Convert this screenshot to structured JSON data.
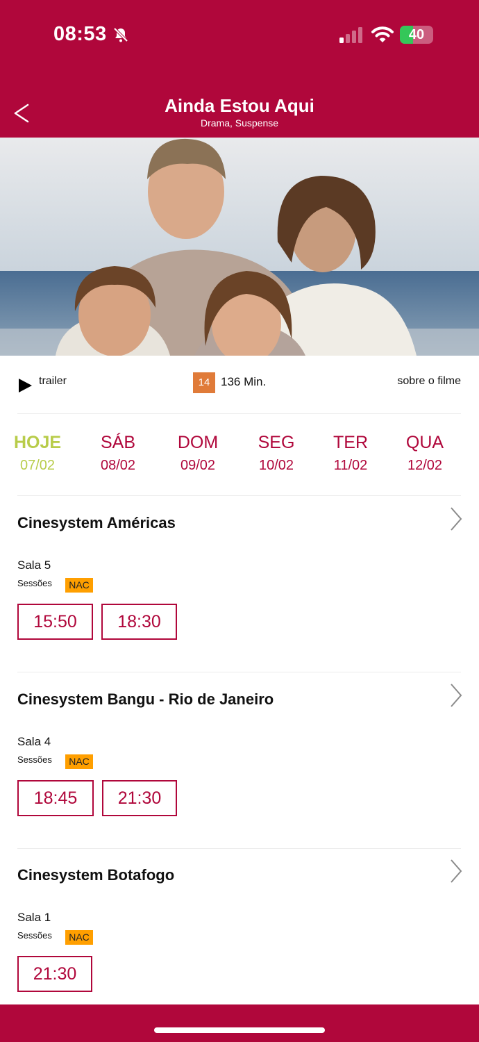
{
  "status_bar": {
    "time": "08:53",
    "battery": "40",
    "battery_level": 0.4
  },
  "header": {
    "title": "Ainda Estou Aqui",
    "genre": "Drama, Suspense"
  },
  "info": {
    "trailer_label": "trailer",
    "rating": "14",
    "duration": "136 Min.",
    "about_link": "sobre o filme"
  },
  "dates": [
    {
      "day": "HOJE",
      "date": "07/02"
    },
    {
      "day": "SÁB",
      "date": "08/02"
    },
    {
      "day": "DOM",
      "date": "09/02"
    },
    {
      "day": "SEG",
      "date": "10/02"
    },
    {
      "day": "TER",
      "date": "11/02"
    },
    {
      "day": "QUA",
      "date": "12/02"
    }
  ],
  "cinemas": [
    {
      "name": "Cinesystem Américas",
      "room": "Sala 5",
      "sessions_label": "Sessões",
      "badge": "NAC",
      "times": [
        "15:50",
        "18:30"
      ]
    },
    {
      "name": "Cinesystem Bangu - Rio de Janeiro",
      "room": "Sala 4",
      "sessions_label": "Sessões",
      "badge": "NAC",
      "times": [
        "18:45",
        "21:30"
      ]
    },
    {
      "name": "Cinesystem Botafogo",
      "room": "Sala 1",
      "sessions_label": "Sessões",
      "badge": "NAC",
      "times": [
        "21:30"
      ]
    }
  ],
  "colors": {
    "brand": "#b0073b",
    "active_date": "#b8cc4a",
    "rating_badge": "#e07b39",
    "nac_badge": "#ff9f00"
  }
}
